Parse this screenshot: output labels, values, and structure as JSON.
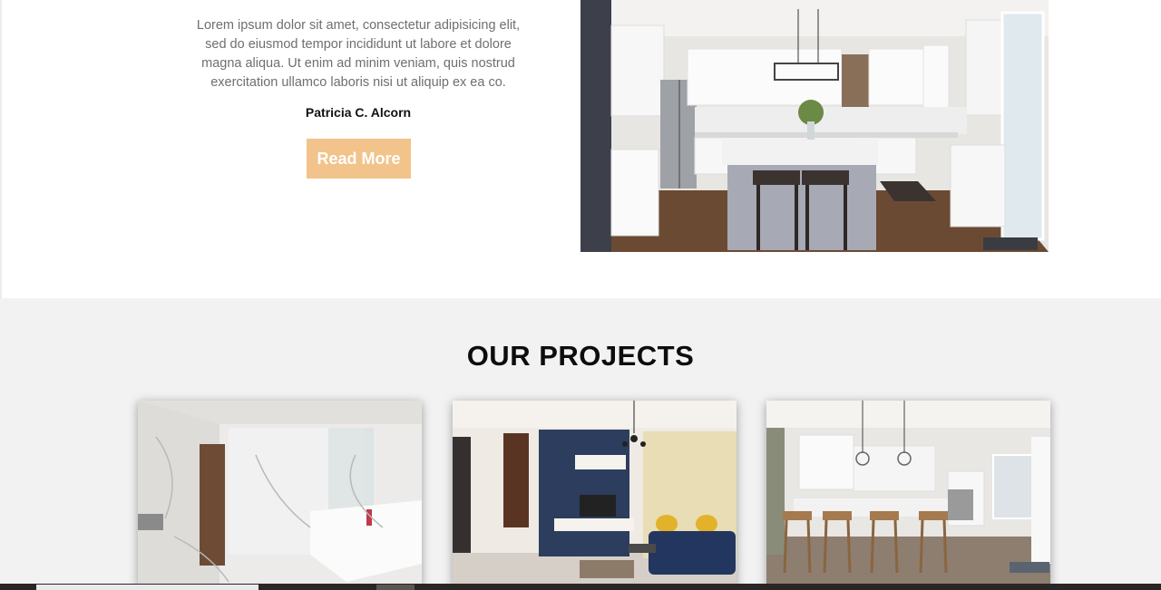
{
  "about": {
    "paragraph": "Lorem ipsum dolor sit amet, consectetur adipisicing elit, sed do eiusmod tempor incididunt ut labore et dolore magna aliqua. Ut enim ad minim veniam, quis nostrud exercitation ullamco laboris nisi ut aliquip ex ea co.",
    "author": "Patricia C. Alcorn",
    "read_more_label": "Read More",
    "image_alt": "kitchen-photo"
  },
  "projects": {
    "title": "OUR PROJECTS",
    "items": [
      {
        "image": "bathroom-photo"
      },
      {
        "image": "living-room-photo"
      },
      {
        "image": "kitchen-island-photo"
      }
    ]
  },
  "colors": {
    "accent": "#f2c38a",
    "section_bg": "#f2f2f2"
  }
}
